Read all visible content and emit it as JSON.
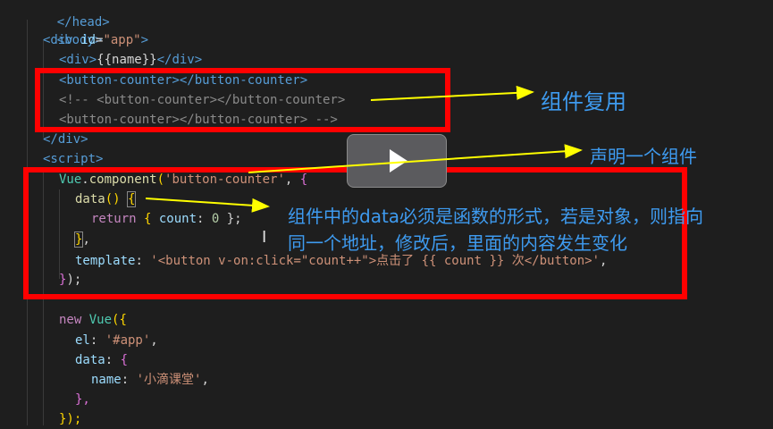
{
  "code_lines": {
    "l0": "</head>",
    "l1": "<body>",
    "l2_open": "<div ",
    "l2_attr": "id",
    "l2_eq": "=",
    "l2_val": "\"app\"",
    "l2_close": ">",
    "l3_open": "<div>",
    "l3_text": "{{name}}",
    "l3_close": "</div>",
    "l4_open": "<button-counter>",
    "l4_close": "</button-counter>",
    "l5": "<!-- <button-counter></button-counter>",
    "l6": "<button-counter></button-counter> -->",
    "l7": "</div>",
    "l8": "<script>",
    "l9_obj": "Vue",
    "l9_dot": ".",
    "l9_fn": "component",
    "l9_paren": "(",
    "l9_str": "'button-counter'",
    "l9_comma": ", ",
    "l9_brace": "{",
    "l10_fn": "data",
    "l10_paren": "()",
    "l10_brace": "{",
    "l11_kw": "return",
    "l11_open": "{ ",
    "l11_prop": "count",
    "l11_colon": ": ",
    "l11_num": "0",
    "l11_close": " };",
    "l12_brace": "}",
    "l12_comma": ",",
    "l13_prop": "template",
    "l13_colon": ": ",
    "l13_str": "'<button v-on:click=\"count++\">点击了 {{ count }} 次</button>'",
    "l13_comma": ",",
    "l14_brace": "}",
    "l14_rest": ");",
    "l16_kw": "new",
    "l16_obj": "Vue",
    "l16_paren": "({",
    "l17_prop": "el",
    "l17_colon": ": ",
    "l17_str": "'#app'",
    "l17_comma": ",",
    "l18_prop": "data",
    "l18_colon": ": ",
    "l18_brace": "{",
    "l19_prop": "name",
    "l19_colon": ": ",
    "l19_str": "'小滴课堂'",
    "l19_comma": ",",
    "l20": "},",
    "l21": "});"
  },
  "annotations": {
    "reuse": "组件复用",
    "declare": "声明一个组件",
    "data_note_1": "组件中的data必须是函数的形式，若是对象，则指向",
    "data_note_2": "同一个地址，修改后，里面的内容发生变化"
  },
  "colors": {
    "highlight_box": "#ff0000",
    "annotation_text": "#3e9bf0",
    "arrow": "#ffff00",
    "background": "#1e1e1e"
  },
  "icons": {
    "play": "play-icon",
    "cursor": "text-cursor-icon"
  }
}
